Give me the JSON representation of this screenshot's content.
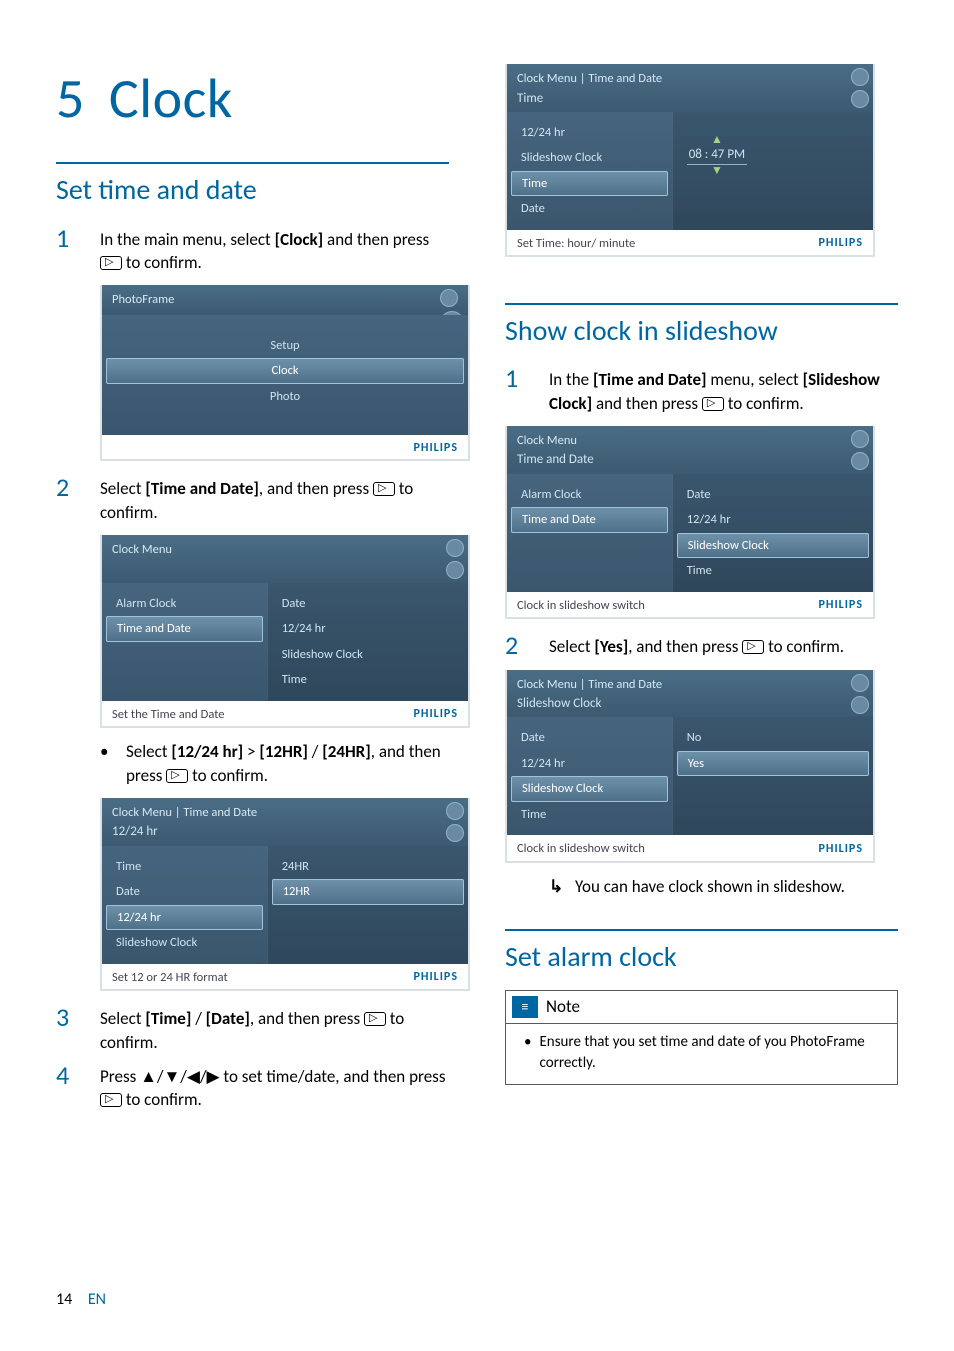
{
  "chapter": {
    "num": "5",
    "title": "Clock"
  },
  "left": {
    "section1": "Set time and date",
    "step1": {
      "a": "In the main menu, select ",
      "b": "[Clock]",
      "c": " and then press ",
      "d": " to confirm."
    },
    "shot1": {
      "title": "PhotoFrame",
      "items": [
        "Setup",
        "Clock",
        "Photo"
      ],
      "brand": "PHILIPS"
    },
    "step2": {
      "a": "Select ",
      "b": "[Time and Date]",
      "c": ", and then press ",
      "d": " to confirm."
    },
    "shot2": {
      "crumb": "Clock Menu",
      "left": [
        "Alarm Clock",
        "Time and Date"
      ],
      "right": [
        "Date",
        "12/24 hr",
        "Slideshow Clock",
        "Time"
      ],
      "hint": "Set the Time and Date",
      "brand": "PHILIPS"
    },
    "sub1": {
      "a": "Select ",
      "b": "[12/24 hr]",
      "c": " > ",
      "d": "[12HR]",
      "e": " / ",
      "f": "[24HR]",
      "g": ", and then press ",
      "h": " to confirm."
    },
    "shot3": {
      "crumb1": "Clock Menu | Time and Date",
      "crumb2": "12/24 hr",
      "left": [
        "Time",
        "Date",
        "12/24 hr",
        "Slideshow Clock"
      ],
      "right": [
        "24HR",
        "12HR"
      ],
      "hint": "Set 12 or 24 HR format",
      "brand": "PHILIPS"
    },
    "step3": {
      "a": "Select ",
      "b": "[Time]",
      "c": " / ",
      "d": "[Date]",
      "e": ", and then press ",
      "f": " to confirm."
    },
    "step4": {
      "a": "Press ▲/▼/◀/▶ to set time/date, and then press ",
      "b": " to confirm."
    }
  },
  "right": {
    "shot4": {
      "crumb1": "Clock Menu | Time and Date",
      "crumb2": "Time",
      "left": [
        "12/24 hr",
        "Slideshow Clock",
        "Time",
        "Date"
      ],
      "time": "08 : 47  PM",
      "hint": "Set Time: hour/ minute",
      "brand": "PHILIPS"
    },
    "section2": "Show clock in slideshow",
    "step1": {
      "a": "In the ",
      "b": "[Time and Date]",
      "c": " menu, select ",
      "d": "[Slideshow Clock]",
      "e": " and then press ",
      "f": " to confirm."
    },
    "shot5": {
      "crumb1": "Clock Menu",
      "crumb2": "Time and Date",
      "left": [
        "Alarm Clock",
        "Time and Date"
      ],
      "right": [
        "Date",
        "12/24 hr",
        "Slideshow Clock",
        "Time"
      ],
      "hint": "Clock in slideshow switch",
      "brand": "PHILIPS"
    },
    "step2": {
      "a": "Select ",
      "b": "[Yes]",
      "c": ", and then press ",
      "d": " to confirm."
    },
    "shot6": {
      "crumb1": "Clock Menu | Time and Date",
      "crumb2": "Slideshow Clock",
      "left": [
        "Date",
        "12/24 hr",
        "Slideshow Clock",
        "Time"
      ],
      "right": [
        "No",
        "Yes"
      ],
      "hint": "Clock in slideshow switch",
      "brand": "PHILIPS"
    },
    "result": "You can have clock shown in slideshow.",
    "section3": "Set alarm clock",
    "note": {
      "title": "Note",
      "body": "Ensure that you set time and date of you PhotoFrame correctly."
    }
  },
  "footer": {
    "page": "14",
    "lang": "EN"
  }
}
